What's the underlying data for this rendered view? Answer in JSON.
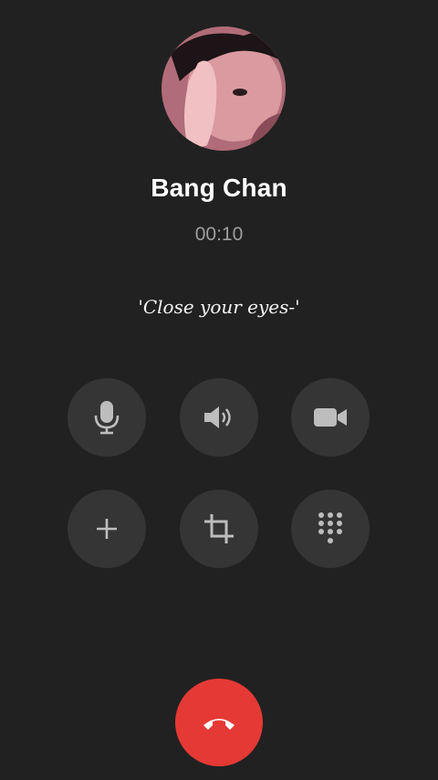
{
  "call": {
    "contact_name": "Bang Chan",
    "duration": "00:10",
    "caption": "'Close your eyes-'"
  },
  "controls": {
    "row1": [
      "microphone-icon",
      "speaker-icon",
      "video-camera-icon"
    ],
    "row2": [
      "add-call-icon",
      "crop-icon",
      "keypad-icon"
    ]
  },
  "end_call": {
    "icon": "hang-up-icon",
    "color": "#e53935"
  },
  "colors": {
    "background": "#212121",
    "button": "#353535",
    "timer": "#9e9e9e"
  }
}
